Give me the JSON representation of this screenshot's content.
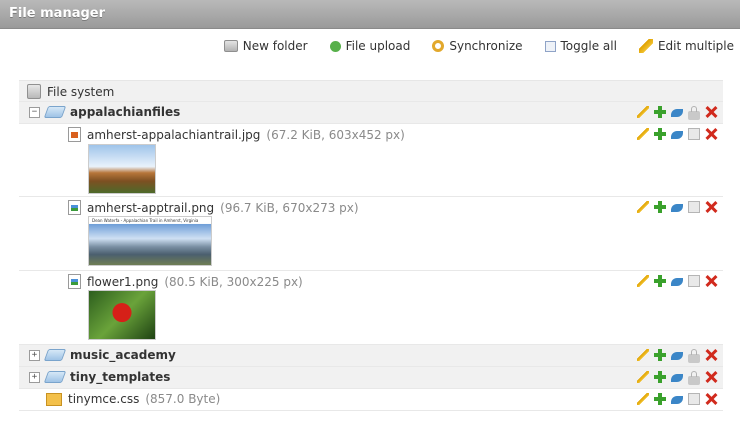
{
  "window": {
    "title": "File manager"
  },
  "toolbar": {
    "new_folder": "New folder",
    "file_upload": "File upload",
    "synchronize": "Synchronize",
    "toggle_all": "Toggle all",
    "edit_multiple": "Edit multiple"
  },
  "tree": {
    "root_label": "File system",
    "folders": [
      {
        "name": "appalachianfiles",
        "expander": "−"
      },
      {
        "name": "music_academy",
        "expander": "+"
      },
      {
        "name": "tiny_templates",
        "expander": "+"
      }
    ],
    "files": [
      {
        "name": "amherst-appalachiantrail.jpg",
        "meta": "(67.2 KiB, 603x452 px)"
      },
      {
        "name": "amherst-apptrail.png",
        "meta": "(96.7 KiB, 670x273 px)",
        "thumb_caption": "Dean Waterfa - Appalachian Trail in Amherst, Virginia"
      },
      {
        "name": "flower1.png",
        "meta": "(80.5 KiB, 300x225 px)"
      },
      {
        "name": "tinymce.css",
        "meta": "(857.0 Byte)"
      }
    ]
  },
  "icons": {
    "new_folder": "new-folder-icon",
    "file_upload": "file-upload-icon",
    "synchronize": "synchronize-icon",
    "toggle_all": "toggle-all-icon",
    "edit_multiple": "edit-multiple-icon"
  },
  "colors": {
    "titlebar": "#a6a6a6",
    "row_background": "#f1f1f1",
    "delete": "#d12a1d",
    "add": "#3aa12c"
  }
}
